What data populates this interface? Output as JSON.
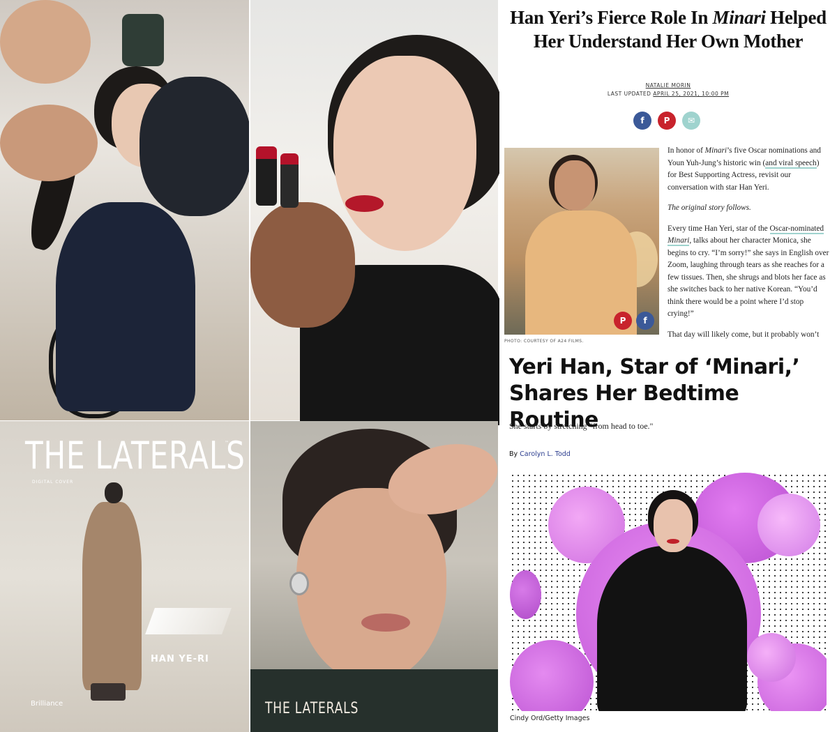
{
  "cover": {
    "magazine_title": "THE LATERALS",
    "trademark": "™",
    "label": "DIGITAL COVER",
    "name": "HAN YE-RI",
    "theme": "Brilliance"
  },
  "portrait": {
    "logo": "THE LATERALS"
  },
  "article1": {
    "title_part1": "Han Yeri’s Fierce Role In ",
    "title_italic": "Minari",
    "title_part2": " Helped Her Understand Her Own Mother",
    "author": "NATALIE MORIN",
    "updated_label": "LAST UPDATED ",
    "updated_date": "APRIL 25, 2021, 10:00 PM",
    "share": {
      "facebook": "f",
      "pinterest": "P",
      "email": "✉"
    },
    "photo_caption": "PHOTO: COURTESY OF A24 FILMS.",
    "p1_a": "In honor of ",
    "p1_italic": "Minari",
    "p1_b": "’s five Oscar nominations and Youn Yuh-Jung’s historic win (",
    "p1_link": "and viral speech",
    "p1_c": ") for Best Supporting Actress, revisit our conversation with star Han Yeri.",
    "p2": "The original story follows.",
    "p3_a": "Every time Han Yeri, star of the ",
    "p3_link": "Oscar-nominated ",
    "p3_link_italic": "Minari",
    "p3_b": ", talks about her character Monica, she begins to cry. “I’m sorry!” she says in English over Zoom, laughing through tears as she reaches for a few tissues. Then, she shrugs and blots her face as she switches back to her native Korean. “You’d think there would be a point where I’d stop crying!”",
    "p4": "That day will likely come, but it probably won’t"
  },
  "article2": {
    "title": "Yeri Han, Star of ‘Minari,’ Shares Her Bedtime Routine",
    "dek": "She starts by stretching \"from head to toe.\"",
    "by_label": "By ",
    "author": "Carolyn L. Todd",
    "photo_credit": "Cindy Ord/Getty Images"
  },
  "colors": {
    "facebook": "#3b5998",
    "pinterest": "#c8232c",
    "email": "#9fd3ce",
    "link_underline": "#9fd3ce",
    "author_link": "#2b3d8f",
    "bubble_purple": "#c45bd9"
  }
}
